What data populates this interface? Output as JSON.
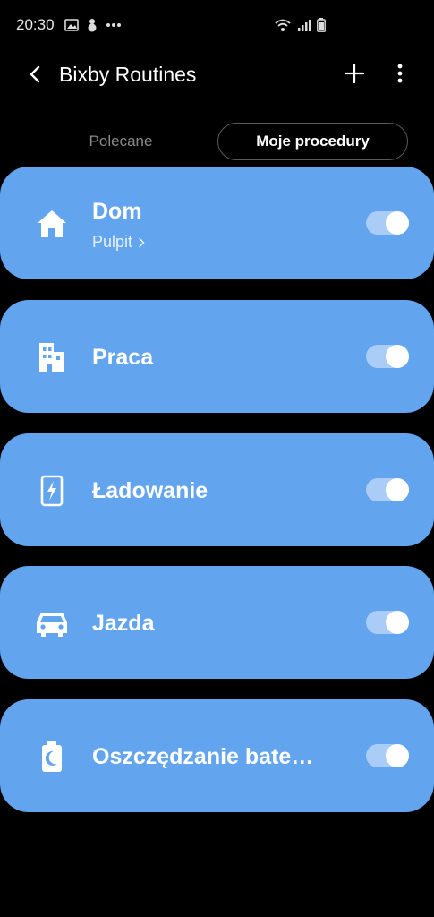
{
  "status_bar": {
    "time": "20:30",
    "left_icons": [
      "image-icon",
      "snowman-icon",
      "dots-icon"
    ],
    "right_icons": [
      "wifi-icon",
      "signal-icon",
      "battery-icon"
    ]
  },
  "header": {
    "title": "Bixby Routines",
    "back_icon": "back-arrow-icon",
    "add_icon": "plus-icon",
    "more_icon": "more-vertical-icon"
  },
  "tabs": [
    {
      "label": "Polecane",
      "selected": false
    },
    {
      "label": "Moje procedury",
      "selected": true
    }
  ],
  "routines": [
    {
      "title": "Dom",
      "subtitle": "Pulpit",
      "icon": "home-icon",
      "enabled": true
    },
    {
      "title": "Praca",
      "icon": "office-building-icon",
      "enabled": true
    },
    {
      "title": "Ładowanie",
      "icon": "charging-phone-icon",
      "enabled": true
    },
    {
      "title": "Jazda",
      "icon": "car-icon",
      "enabled": true
    },
    {
      "title": "Oszczędzanie bate…",
      "icon": "battery-moon-icon",
      "enabled": true
    }
  ],
  "colors": {
    "background": "#000000",
    "card": "#62a4ee",
    "toggle_track": "#a9cdf6",
    "toggle_knob": "#ffffff"
  }
}
